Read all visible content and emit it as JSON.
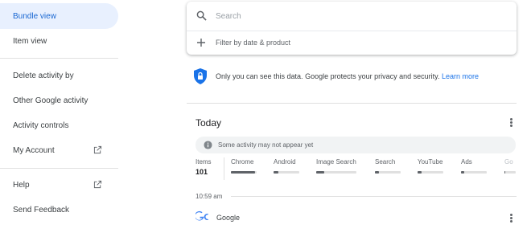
{
  "sidebar": {
    "items": [
      {
        "label": "Bundle view"
      },
      {
        "label": "Item view"
      },
      {
        "label": "Delete activity by"
      },
      {
        "label": "Other Google activity"
      },
      {
        "label": "Activity controls"
      },
      {
        "label": "My Account"
      },
      {
        "label": "Help"
      },
      {
        "label": "Send Feedback"
      }
    ]
  },
  "search": {
    "placeholder": "Search",
    "filter_label": "Filter by date & product"
  },
  "privacy": {
    "text": "Only you can see this data. Google protects your privacy and security.",
    "link": "Learn more"
  },
  "today": {
    "title": "Today",
    "notice": "Some activity may not appear yet",
    "items_label": "Items",
    "items_count": "101",
    "products": [
      {
        "name": "Chrome",
        "share": 0.95
      },
      {
        "name": "Android",
        "share": 0.2
      },
      {
        "name": "Image Search",
        "share": 0.2
      },
      {
        "name": "Search",
        "share": 0.15
      },
      {
        "name": "YouTube",
        "share": 0.15
      },
      {
        "name": "Ads",
        "share": 0.12
      },
      {
        "name": "Go",
        "share": 0.1
      }
    ]
  },
  "entry": {
    "time": "10:59 am",
    "product": "Google"
  },
  "colors": {
    "accent": "#1a73e8",
    "active_bg": "#e8f0fe",
    "shield": "#1a73e8"
  }
}
